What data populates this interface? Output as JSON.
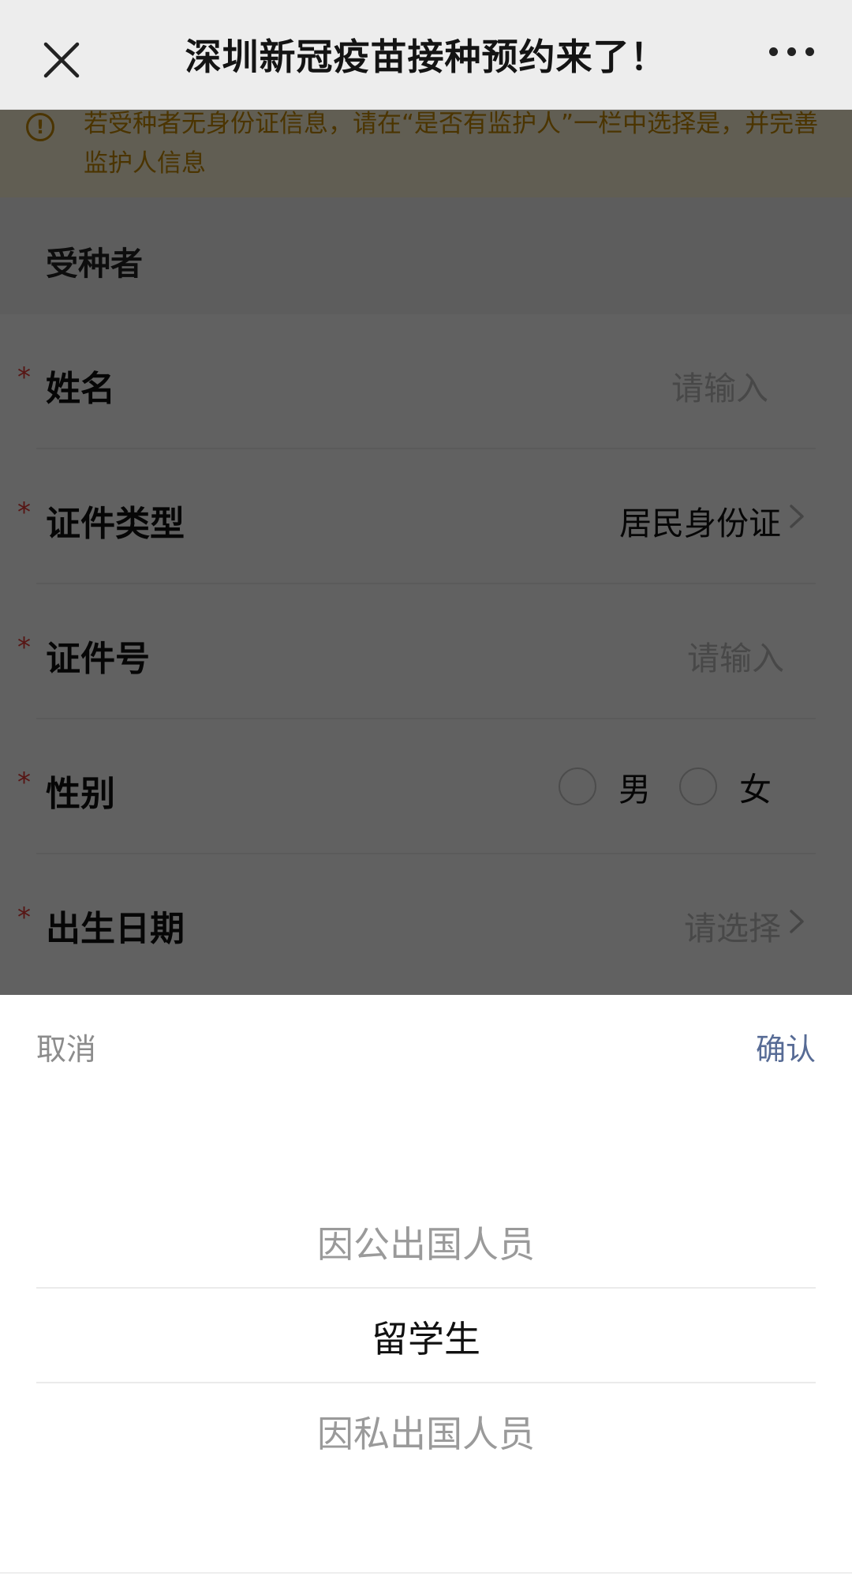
{
  "nav": {
    "title": "深圳新冠疫苗接种预约来了！",
    "close_icon": "close-icon",
    "more_icon": "more-icon"
  },
  "notice": {
    "text": "若受种者无身份证信息，请在“是否有监护人”一栏中选择是，并完善监护人信息",
    "icon": "info-icon",
    "color": "#c48a00"
  },
  "section": {
    "title": "受种者"
  },
  "form": {
    "required_mark": "*",
    "name": {
      "label": "姓名",
      "placeholder": "请输入"
    },
    "id_type": {
      "label": "证件类型",
      "value": "居民身份证"
    },
    "id_number": {
      "label": "证件号",
      "placeholder": "请输入"
    },
    "gender": {
      "label": "性别",
      "options": [
        "男",
        "女"
      ]
    },
    "birthdate": {
      "label": "出生日期",
      "placeholder": "请选择"
    }
  },
  "picker": {
    "cancel": "取消",
    "confirm": "确认",
    "confirm_color": "#576b95",
    "options": [
      "因公出国人员",
      "留学生",
      "因私出国人员"
    ],
    "selected": "留学生"
  }
}
